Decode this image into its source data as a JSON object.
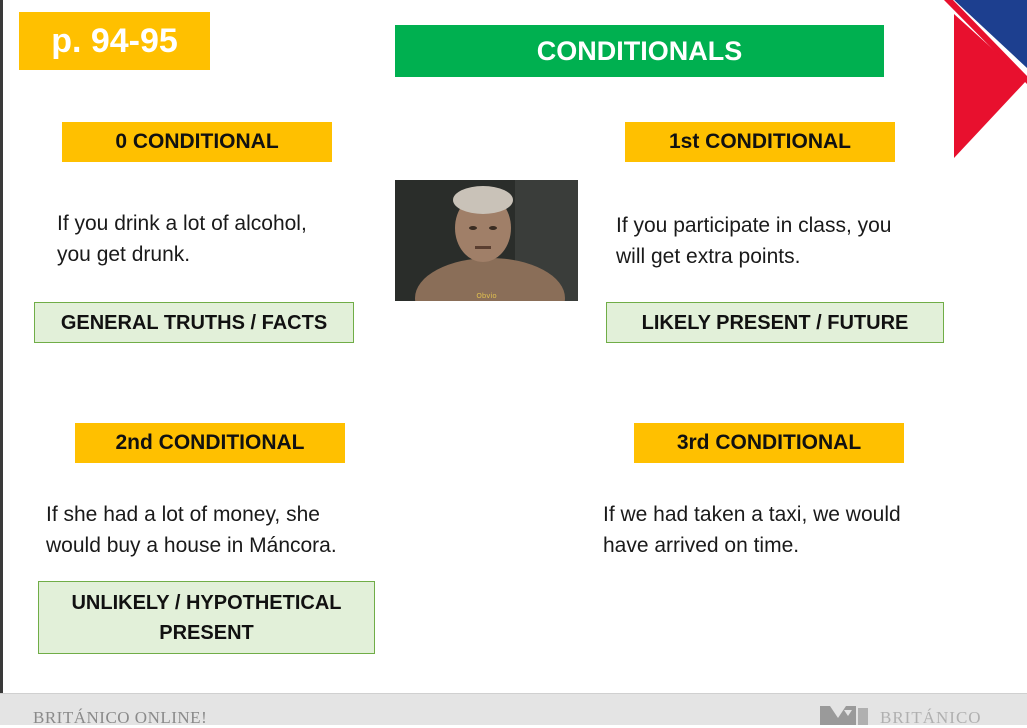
{
  "header": {
    "page_ref": "p. 94-95",
    "title": "CONDITIONALS"
  },
  "colors": {
    "badge_yellow": "#ffc000",
    "title_green": "#00b050",
    "category_fill": "#e2f0d9",
    "category_border": "#70ad47",
    "flag_red": "#e8102e",
    "flag_blue": "#1d3f8f"
  },
  "conditionals": [
    {
      "label": "0 CONDITIONAL",
      "example_line1": "If you drink a lot of alcohol,",
      "example_line2": "you get drunk.",
      "category_line1": "GENERAL TRUTHS / FACTS",
      "category_line2": ""
    },
    {
      "label": "1st CONDITIONAL",
      "example_line1": "If you participate in class, you",
      "example_line2": "will get extra points.",
      "category_line1": "LIKELY PRESENT / FUTURE",
      "category_line2": ""
    },
    {
      "label": "2nd CONDITIONAL",
      "example_line1": "If she had a lot of money, she",
      "example_line2": "would buy a house in Máncora.",
      "category_line1": "UNLIKELY / HYPOTHETICAL",
      "category_line2": "PRESENT"
    },
    {
      "label": "3rd CONDITIONAL",
      "example_line1": "If we had taken a taxi, we would",
      "example_line2": "have arrived on time."
    }
  ],
  "video": {
    "caption": "Obvio"
  },
  "footer": {
    "left_text": "BRITÁNICO ONLINE!",
    "right_text": "BRITÁNICO",
    "logo_icon": "britanico-logo-icon"
  }
}
